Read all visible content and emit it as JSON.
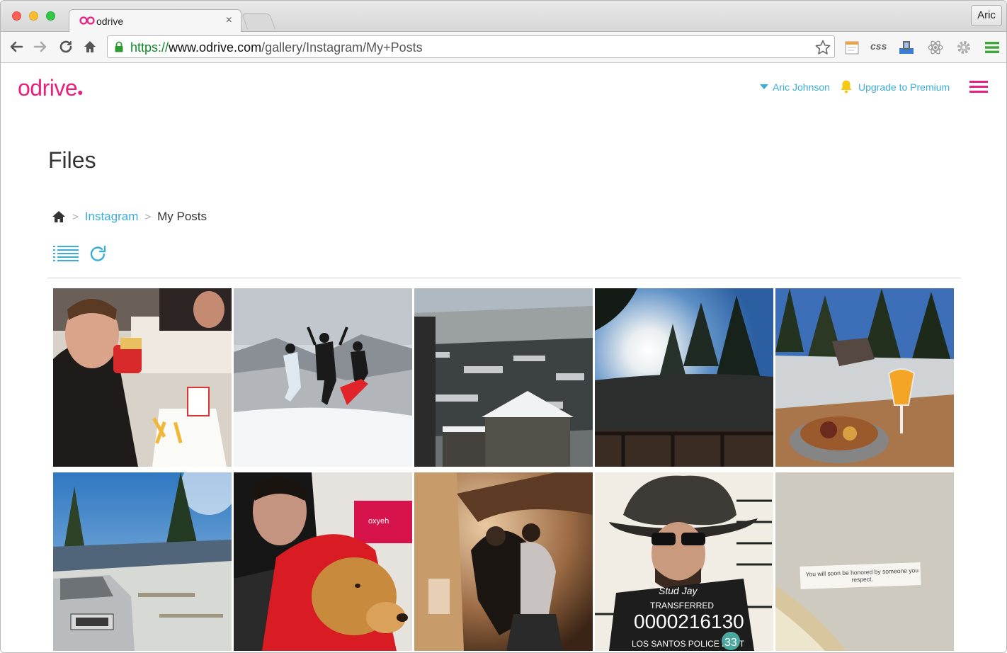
{
  "browser": {
    "tab_title": "odrive",
    "tab_close": "×",
    "profile_name": "Aric",
    "url": {
      "scheme": "https://",
      "host": "www.odrive.com",
      "path": "/gallery/Instagram/My+Posts"
    },
    "extensions": [
      "notes-icon",
      "css-icon",
      "upload-icon",
      "react-icon",
      "gear-icon",
      "menu-icon"
    ],
    "css_ext_label": "css"
  },
  "app": {
    "brand": "odrive",
    "brand_color": "#e9207e",
    "link_color": "#3aaed8",
    "user": "Aric Johnson",
    "upgrade": "Upgrade to Premium"
  },
  "page": {
    "title": "Files",
    "breadcrumb": [
      "Instagram",
      "My Posts"
    ]
  },
  "gallery": {
    "photos": [
      {
        "name": "photo-burger",
        "theme": "indoor-red"
      },
      {
        "name": "photo-ski-jump",
        "theme": "snow"
      },
      {
        "name": "photo-mountain-village",
        "theme": "village"
      },
      {
        "name": "photo-sun-trees",
        "theme": "sun-trees"
      },
      {
        "name": "photo-breakfast",
        "theme": "breakfast"
      },
      {
        "name": "photo-car-snow",
        "theme": "car"
      },
      {
        "name": "photo-dog-hoodie",
        "theme": "dog"
      },
      {
        "name": "photo-hug",
        "theme": "warm"
      },
      {
        "name": "photo-mugshot",
        "theme": "mugshot"
      },
      {
        "name": "photo-fortune",
        "theme": "fortune"
      }
    ],
    "mugshot_text": {
      "name": "Stud Jay",
      "status": "TRANSFERRED",
      "number": "0000216130",
      "dept": "LOS SANTOS POLICE DEPT",
      "badge": "33"
    },
    "fortune_text": "You will soon be honored by someone you respect.",
    "shirt_text": "oxyeh"
  }
}
